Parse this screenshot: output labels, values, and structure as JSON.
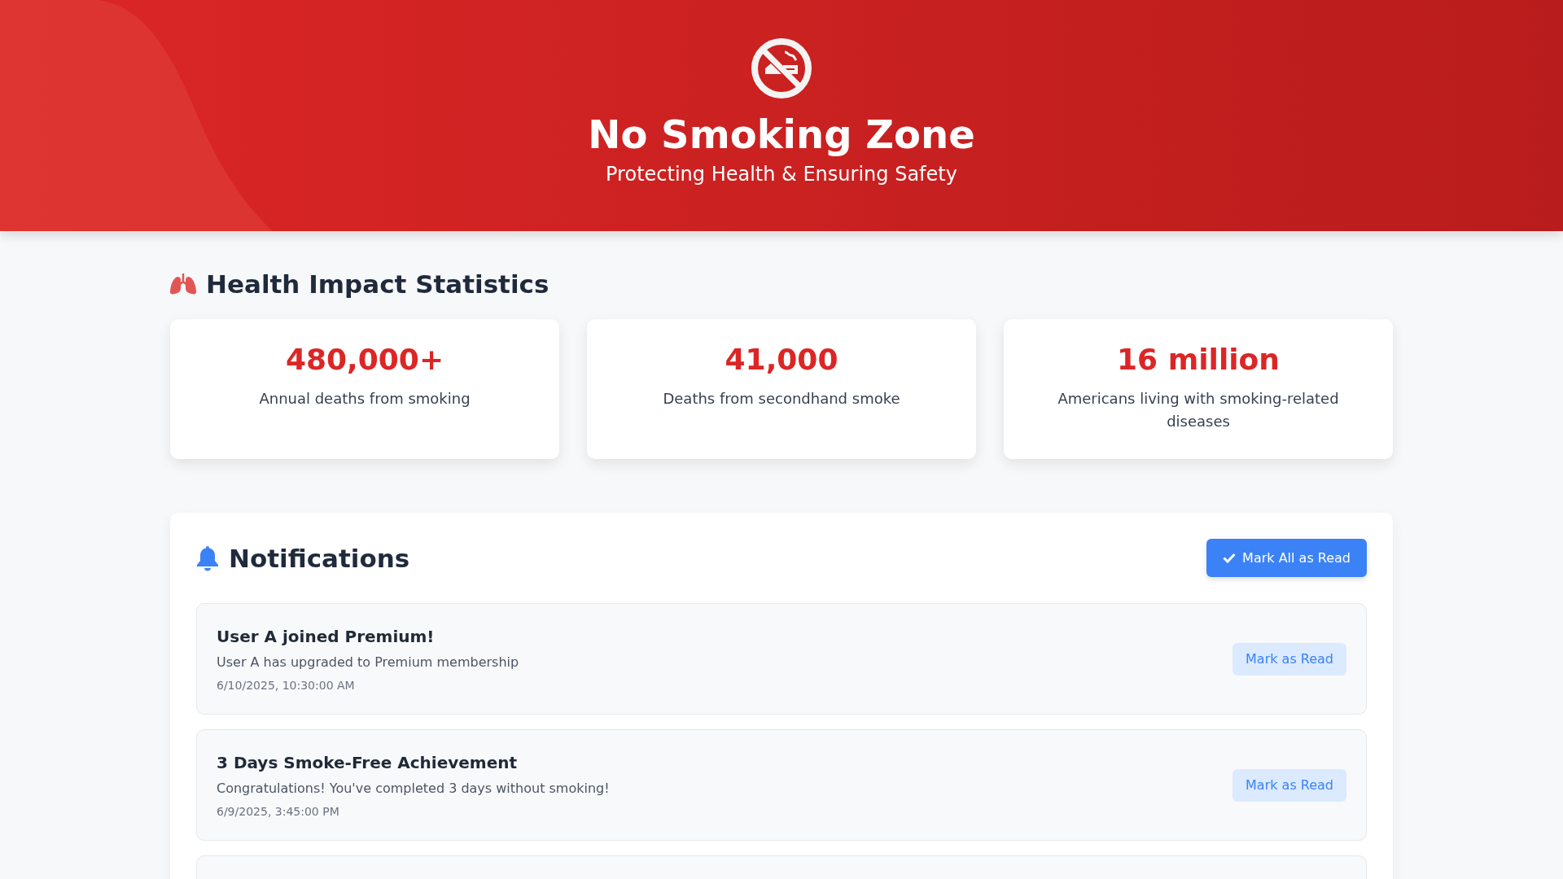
{
  "header": {
    "title": "No Smoking Zone",
    "subtitle": "Protecting Health & Ensuring Safety"
  },
  "statistics": {
    "heading": "Health Impact Statistics",
    "cards": [
      {
        "value": "480,000+",
        "label": "Annual deaths from smoking"
      },
      {
        "value": "41,000",
        "label": "Deaths from secondhand smoke"
      },
      {
        "value": "16 million",
        "label": "Americans living with smoking-related diseases"
      }
    ]
  },
  "notifications": {
    "heading": "Notifications",
    "mark_all_button": "Mark All as Read",
    "items": [
      {
        "title": "User A joined Premium!",
        "message": "User A has upgraded to Premium membership",
        "time": "6/10/2025, 10:30:00 AM",
        "button": "Mark as Read"
      },
      {
        "title": "3 Days Smoke-Free Achievement",
        "message": "Congratulations! You've completed 3 days without smoking!",
        "time": "6/9/2025, 3:45:00 PM",
        "button": "Mark as Read"
      }
    ]
  }
}
